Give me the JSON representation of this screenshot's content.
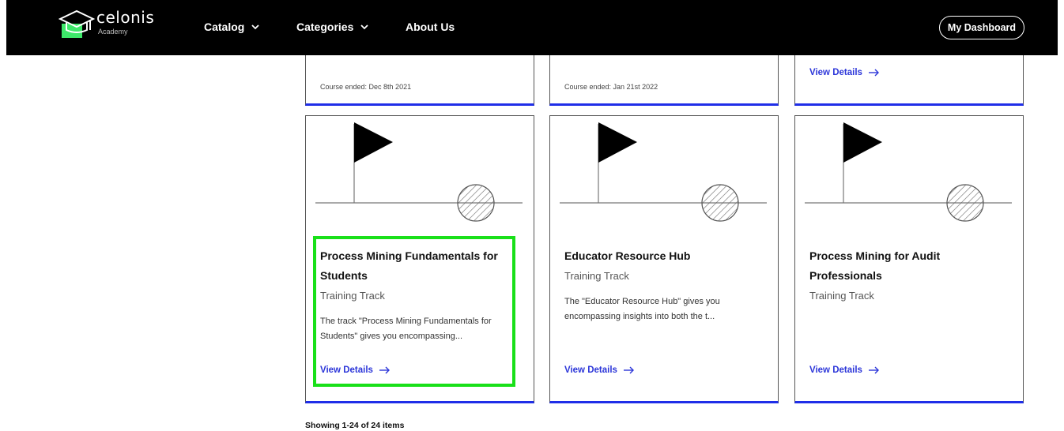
{
  "header": {
    "logo_name": "celonis",
    "logo_sub": "Academy",
    "nav": [
      {
        "label": "Catalog"
      },
      {
        "label": "Categories"
      },
      {
        "label": "About Us"
      }
    ],
    "dashboard_label": "My Dashboard"
  },
  "top_cards": [
    {
      "ended": "Course ended: Dec 8th 2021"
    },
    {
      "ended": "Course ended: Jan 21st 2022"
    },
    {
      "view": "View Details"
    }
  ],
  "cards": [
    {
      "title": "Process Mining Fundamentals for Students",
      "subtitle": "Training Track",
      "description": "The track \"Process Mining Fundamentals for Students\" gives you encompassing...",
      "view": "View Details"
    },
    {
      "title": "Educator Resource Hub",
      "subtitle": "Training Track",
      "description": "The \"Educator Resource Hub\" gives you encompassing insights into both the t...",
      "view": "View Details"
    },
    {
      "title": "Process Mining for Audit Professionals",
      "subtitle": "Training Track",
      "description": "",
      "view": "View Details"
    }
  ],
  "footer": {
    "showing": "Showing 1-24 of 24 items"
  },
  "colors": {
    "header_bg": "#000000",
    "accent_blue": "#1f2ee8",
    "link_blue": "#2c36d9",
    "highlight_green": "#19e019",
    "logo_green": "#3ee86a"
  },
  "icons": [
    "graduation-cap-icon",
    "chevron-down-icon",
    "arrow-right-icon",
    "flag-icon",
    "hatched-circle-icon"
  ]
}
